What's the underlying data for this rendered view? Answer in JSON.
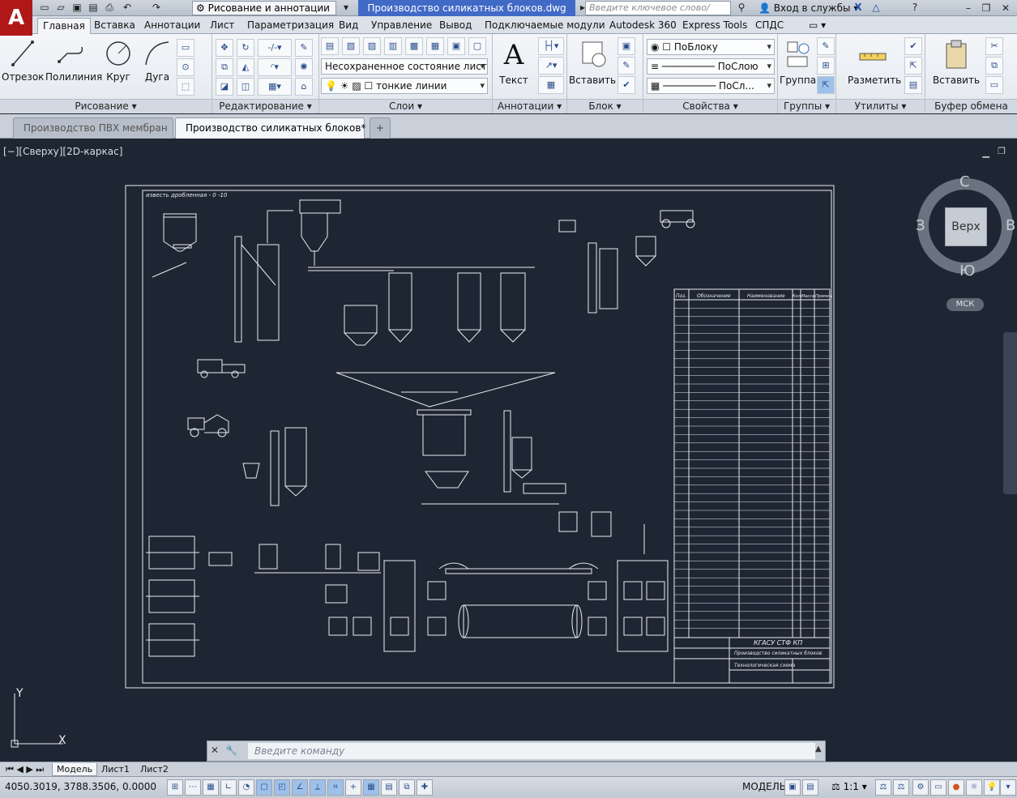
{
  "titlebar": {
    "workspace": "Рисование и аннотации",
    "document_title": "Производство силикатных блоков.dwg",
    "search_placeholder": "Введите ключевое слово/фразу",
    "signin": "Вход в службы"
  },
  "ribbon_tabs": [
    "Главная",
    "Вставка",
    "Аннотации",
    "Лист",
    "Параметризация",
    "Вид",
    "Управление",
    "Вывод",
    "Подключаемые модули",
    "Autodesk 360",
    "Express Tools",
    "СПДС"
  ],
  "ribbon": {
    "draw": {
      "title": "Рисование",
      "tools": [
        "Отрезок",
        "Полилиния",
        "Круг",
        "Дуга"
      ]
    },
    "modify": {
      "title": "Редактирование"
    },
    "layers": {
      "title": "Слои",
      "state": "Несохраненное состояние листа",
      "layer": "тонкие линии"
    },
    "annotation": {
      "title": "Аннотации",
      "text_tool": "Текст"
    },
    "block": {
      "title": "Блок",
      "insert": "Вставить"
    },
    "properties": {
      "title": "Свойства",
      "color": "ПоБлоку",
      "linetype": "ПоСлою",
      "lineweight": "ПоСл..."
    },
    "groups": {
      "title": "Группы",
      "group": "Группа"
    },
    "utilities": {
      "title": "Утилиты",
      "measure": "Разметить"
    },
    "clipboard": {
      "title": "Буфер обмена",
      "paste": "Вставить"
    }
  },
  "doc_tabs": [
    "Производство ПВХ мембран",
    "Производство силикатных блоков*"
  ],
  "viewport_label": "[−][Сверху][2D-каркас]",
  "viewcube": {
    "north": "С",
    "south": "Ю",
    "west": "З",
    "east": "В",
    "face": "Верх",
    "ucs": "МСК"
  },
  "drawing": {
    "header_note": "известь дробленная - 0 -10",
    "title_block": {
      "org": "КГАСУ СТФ КП",
      "name": "Производство силикатных блоков",
      "sheet": "Технологическая схема"
    },
    "table_headers": [
      "Поз.",
      "Обозначение",
      "Наименование",
      "Кол.",
      "Масса",
      "Примеч."
    ]
  },
  "command_line": {
    "placeholder": "Введите команду"
  },
  "layout_tabs": [
    "Модель",
    "Лист1",
    "Лист2"
  ],
  "status": {
    "coords": "4050.3019, 3788.3506, 0.0000",
    "mode": "МОДЕЛЬ",
    "scale": "1:1"
  },
  "colors": {
    "canvas": "#1f2633",
    "accent": "#4169c6",
    "logo": "#b01818"
  }
}
